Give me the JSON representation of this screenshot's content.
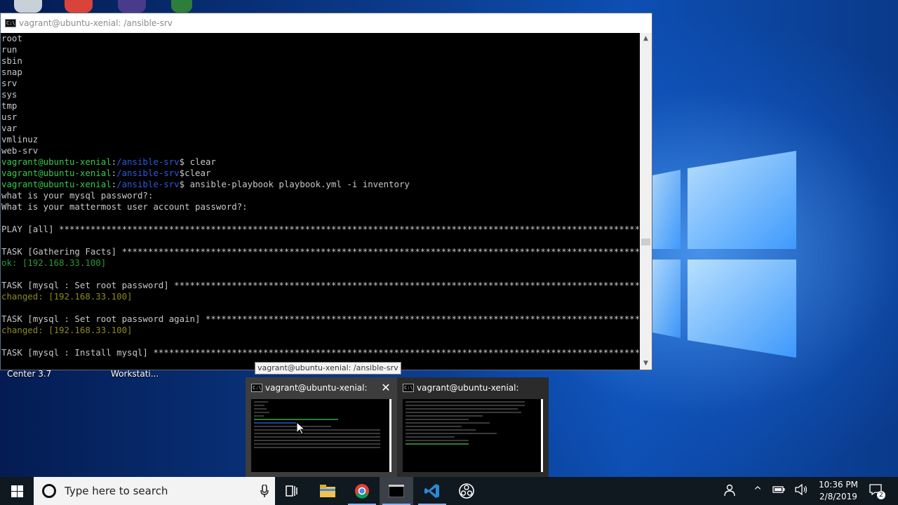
{
  "terminal": {
    "title": "vagrant@ubuntu-xenial: /ansible-srv",
    "icon": "cmd-icon",
    "lines": [
      {
        "segments": [
          {
            "text": "root",
            "color": "default"
          }
        ]
      },
      {
        "segments": [
          {
            "text": "run",
            "color": "default"
          }
        ]
      },
      {
        "segments": [
          {
            "text": "sbin",
            "color": "default"
          }
        ]
      },
      {
        "segments": [
          {
            "text": "snap",
            "color": "default"
          }
        ]
      },
      {
        "segments": [
          {
            "text": "srv",
            "color": "default"
          }
        ]
      },
      {
        "segments": [
          {
            "text": "sys",
            "color": "default"
          }
        ]
      },
      {
        "segments": [
          {
            "text": "tmp",
            "color": "default"
          }
        ]
      },
      {
        "segments": [
          {
            "text": "usr",
            "color": "default"
          }
        ]
      },
      {
        "segments": [
          {
            "text": "var",
            "color": "default"
          }
        ]
      },
      {
        "segments": [
          {
            "text": "vmlinuz",
            "color": "default"
          }
        ]
      },
      {
        "segments": [
          {
            "text": "web-srv",
            "color": "default"
          }
        ]
      },
      {
        "segments": [
          {
            "text": "vagrant@ubuntu-xenial",
            "color": "green"
          },
          {
            "text": ":",
            "color": "default"
          },
          {
            "text": "/ansible-srv",
            "color": "blue"
          },
          {
            "text": "$ clear",
            "color": "default"
          }
        ]
      },
      {
        "segments": [
          {
            "text": "vagrant@ubuntu-xenial",
            "color": "green"
          },
          {
            "text": ":",
            "color": "default"
          },
          {
            "text": "/ansible-srv",
            "color": "blue"
          },
          {
            "text": "$clear",
            "color": "default"
          }
        ]
      },
      {
        "segments": [
          {
            "text": "vagrant@ubuntu-xenial",
            "color": "green"
          },
          {
            "text": ":",
            "color": "default"
          },
          {
            "text": "/ansible-srv",
            "color": "blue"
          },
          {
            "text": "$ ansible-playbook playbook.yml -i inventory",
            "color": "default"
          }
        ]
      },
      {
        "segments": [
          {
            "text": "what is your mysql password?:",
            "color": "default"
          }
        ]
      },
      {
        "segments": [
          {
            "text": "What is your mattermost user account password?:",
            "color": "default"
          }
        ]
      },
      {
        "segments": [
          {
            "text": "",
            "color": "default"
          }
        ]
      },
      {
        "segments": [
          {
            "text": "PLAY [all] ******************************************************************************************************************",
            "color": "default"
          }
        ]
      },
      {
        "segments": [
          {
            "text": "",
            "color": "default"
          }
        ]
      },
      {
        "segments": [
          {
            "text": "TASK [Gathering Facts] ******************************************************************************************************",
            "color": "default"
          }
        ]
      },
      {
        "segments": [
          {
            "text": "ok: [192.168.33.100]",
            "color": "ok"
          }
        ]
      },
      {
        "segments": [
          {
            "text": "",
            "color": "default"
          }
        ]
      },
      {
        "segments": [
          {
            "text": "TASK [mysql : Set root password] ********************************************************************************************",
            "color": "default"
          }
        ]
      },
      {
        "segments": [
          {
            "text": "changed: [192.168.33.100]",
            "color": "olive"
          }
        ]
      },
      {
        "segments": [
          {
            "text": "",
            "color": "default"
          }
        ]
      },
      {
        "segments": [
          {
            "text": "TASK [mysql : Set root password again] **************************************************************************************",
            "color": "default"
          }
        ]
      },
      {
        "segments": [
          {
            "text": "changed: [192.168.33.100]",
            "color": "olive"
          }
        ]
      },
      {
        "segments": [
          {
            "text": "",
            "color": "default"
          }
        ]
      },
      {
        "segments": [
          {
            "text": "TASK [mysql : Install mysql] ************************************************************************************************",
            "color": "default"
          }
        ]
      }
    ]
  },
  "desktop": {
    "labels": [
      "Center 3.7",
      "Workstati..."
    ]
  },
  "tooltip": "vagrant@ubuntu-xenial: /ansible-srv",
  "previews": [
    {
      "title": "vagrant@ubuntu-xenial: ...",
      "close": "✕"
    },
    {
      "title": "vagrant@ubuntu-xenial: ~"
    }
  ],
  "taskbar": {
    "search_placeholder": "Type here to search",
    "time": "10:36 PM",
    "date": "2/8/2019",
    "notifications": "2",
    "icons": [
      "start-icon",
      "cortana-icon",
      "microphone-icon",
      "task-view-icon",
      "file-explorer-icon",
      "chrome-icon",
      "terminal-icon",
      "vscode-icon",
      "obs-icon"
    ]
  },
  "colors": {
    "prompt_green": "#36c94b",
    "path_blue": "#2b5be0",
    "changed": "#8c8a1e",
    "ok": "#2a9a36"
  }
}
